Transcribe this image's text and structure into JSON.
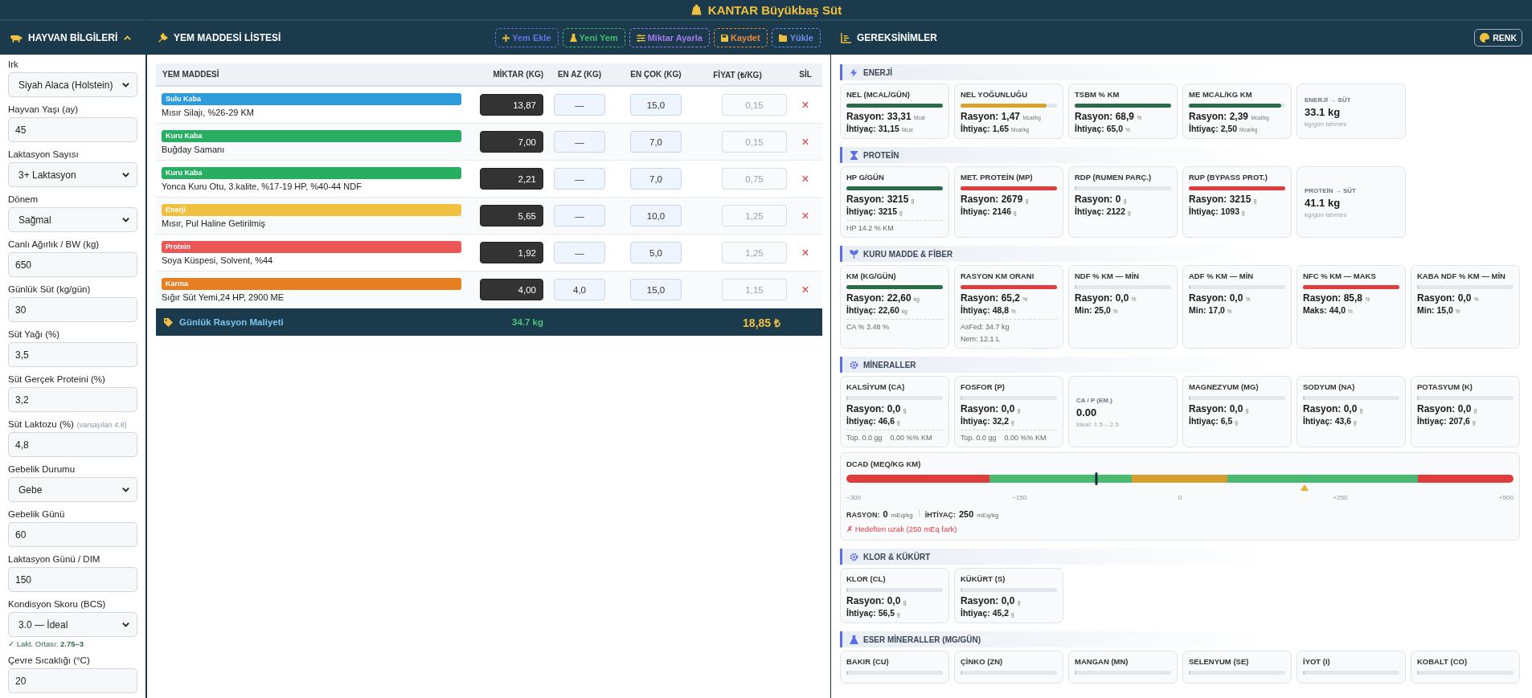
{
  "app_title": "KANTAR Büyükbaş Süt",
  "animal_panel": {
    "title": "HAYVAN BİLGİLERİ",
    "expanded": true,
    "fields": [
      {
        "label": "Irk",
        "kind": "select",
        "value": "Siyah Alaca (Holstein)"
      },
      {
        "label": "Hayvan Yaşı (ay)",
        "kind": "input",
        "value": "45"
      },
      {
        "label": "Laktasyon Sayısı",
        "kind": "select",
        "value": "3+ Laktasyon"
      },
      {
        "label": "Dönem",
        "kind": "select",
        "value": "Sağmal"
      },
      {
        "label": "Canlı Ağırlık / BW (kg)",
        "kind": "input",
        "value": "650"
      },
      {
        "label": "Günlük Süt (kg/gün)",
        "kind": "input",
        "value": "30"
      },
      {
        "label": "Süt Yağı (%)",
        "kind": "input",
        "value": "3,5"
      },
      {
        "label": "Süt Gerçek Proteini (%)",
        "kind": "input",
        "value": "3,2"
      },
      {
        "label": "Süt Laktozu (%)",
        "hint": "(varsayılan 4.8)",
        "kind": "input",
        "value": "4,8"
      },
      {
        "label": "Gebelik Durumu",
        "kind": "select",
        "value": "Gebe"
      },
      {
        "label": "Gebelik Günü",
        "kind": "input",
        "value": "60"
      },
      {
        "label": "Laktasyon Günü / DIM",
        "kind": "input",
        "value": "150"
      },
      {
        "label": "Kondisyon Skoru (BCS)",
        "kind": "select",
        "value": "3.0 — İdeal",
        "note": "✓ Lakt. Ortası: **2.75–3**"
      },
      {
        "label": "Çevre Sıcaklığı (°C)",
        "kind": "input",
        "value": "20"
      }
    ]
  },
  "feed_panel": {
    "title": "YEM MADDESİ LİSTESİ",
    "buttons": [
      {
        "label": "Yem Ekle",
        "kind": "add",
        "color": "#6373e8"
      },
      {
        "label": "Yeni Yem",
        "kind": "flask",
        "color": "#3fbf6a"
      },
      {
        "label": "Miktar Ayarla",
        "kind": "sliders",
        "color": "#a77bf0"
      },
      {
        "label": "Kaydet",
        "kind": "save",
        "color": "#f08a3c"
      },
      {
        "label": "Yükle",
        "kind": "folder",
        "color": "#6f8cf0"
      }
    ],
    "columns": [
      "YEM MADDESİ",
      "MİKTAR (KG)",
      "EN AZ (KG)",
      "EN ÇOK (KG)",
      "FİYAT (₺/KG)",
      "SİL"
    ],
    "rows": [
      {
        "category": "Sulu Kaba",
        "color": "#2e9bdb",
        "name": "Mısır Silajı, %26-29 KM",
        "amount": "13,87",
        "min": "—",
        "max": "15,0",
        "price": "0,15",
        "delete": "×"
      },
      {
        "category": "Kuru Kaba",
        "color": "#27ae60",
        "name": "Buğday Samanı",
        "amount": "7,00",
        "min": "—",
        "max": "7,0",
        "price": "0,15",
        "delete": "×"
      },
      {
        "category": "Kuru Kaba",
        "color": "#27ae60",
        "name": "Yonca Kuru Otu, 3.kalite, %17-19 HP, %40-44 NDF",
        "amount": "2,21",
        "min": "—",
        "max": "7,0",
        "price": "0,75",
        "delete": "×"
      },
      {
        "category": "Enerji",
        "color": "#f0c040",
        "name": "Mısır, Pul Haline Getirilmiş",
        "amount": "5,65",
        "min": "—",
        "max": "10,0",
        "price": "1,25",
        "delete": "×"
      },
      {
        "category": "Protein",
        "color": "#eb5757",
        "name": "Soya Küspesi, Solvent, %44",
        "amount": "1,92",
        "min": "—",
        "max": "5,0",
        "price": "1,25",
        "delete": "×"
      },
      {
        "category": "Karma",
        "color": "#e67e22",
        "name": "Sığır Süt Yemi,24 HP, 2900 ME",
        "amount": "4,00",
        "min": "4,0",
        "max": "15,0",
        "price": "1,15",
        "delete": "×"
      }
    ],
    "footer": {
      "label": "Günlük Rasyon Maliyeti",
      "total_weight": "34.7 kg",
      "total_cost": "18,85 ₺"
    }
  },
  "requirements_panel": {
    "title": "GEREKSİNİMLER",
    "color_button": "RENK",
    "sections": [
      {
        "title": "ENERJİ",
        "cards": [
          {
            "kind": "metric",
            "title": "NEL (MCAL/GÜN)",
            "level": 1,
            "color": "#2a6b48",
            "lines": [
              {
                "label": "Rasyon:",
                "value": "33,31",
                "unit": "Mcal"
              },
              {
                "label": "İhtiyaç:",
                "value": "31,15",
                "unit": "Mcal"
              }
            ]
          },
          {
            "kind": "metric",
            "title": "NEL YOĞUNLUĞU",
            "level": 0.89,
            "color": "#d9a22a",
            "lines": [
              {
                "label": "Rasyon:",
                "value": "1,47",
                "unit": "Mcal/kg"
              },
              {
                "label": "İhtiyaç:",
                "value": "1,65",
                "unit": "Mcal/kg"
              }
            ]
          },
          {
            "kind": "metric",
            "title": "TSBM % KM",
            "level": 1,
            "color": "#2a6b48",
            "lines": [
              {
                "label": "Rasyon:",
                "value": "68,9",
                "unit": "%"
              },
              {
                "label": "İhtiyaç:",
                "value": "65,0",
                "unit": "%"
              }
            ]
          },
          {
            "kind": "metric",
            "title": "ME MCAL/KG KM",
            "level": 0.96,
            "color": "#2a6b48",
            "lines": [
              {
                "label": "Rasyon:",
                "value": "2,39",
                "unit": "Mcal/kg"
              },
              {
                "label": "İhtiyaç:",
                "value": "2,50",
                "unit": "Mcal/kg"
              }
            ]
          },
          {
            "kind": "summary",
            "title": "ENERJİ → SÜT",
            "value": "33.1 kg",
            "sub": "kg/gün tahmini"
          }
        ]
      },
      {
        "title": "PROTEİN",
        "cards": [
          {
            "kind": "metric",
            "title": "HP G/GÜN",
            "level": 1,
            "color": "#2a6b48",
            "lines": [
              {
                "label": "Rasyon:",
                "value": "3215",
                "unit": "g"
              },
              {
                "label": "İhtiyaç:",
                "value": "3215",
                "unit": "g"
              }
            ],
            "notes": [
              "HP 14.2 % KM"
            ]
          },
          {
            "kind": "metric",
            "title": "MET. PROTEİN (MP)",
            "level": 1,
            "color": "#e03c3c",
            "lines": [
              {
                "label": "Rasyon:",
                "value": "2679",
                "unit": "g"
              },
              {
                "label": "İhtiyaç:",
                "value": "2146",
                "unit": "g"
              }
            ]
          },
          {
            "kind": "metric",
            "title": "RDP (RUMEN PARÇ.)",
            "level": 0,
            "lines": [
              {
                "label": "Rasyon:",
                "value": "0",
                "unit": "g"
              },
              {
                "label": "İhtiyaç:",
                "value": "2122",
                "unit": "g"
              }
            ]
          },
          {
            "kind": "metric",
            "title": "RUP (BYPASS PROT.)",
            "level": 1,
            "color": "#e03c3c",
            "lines": [
              {
                "label": "Rasyon:",
                "value": "3215",
                "unit": "g"
              },
              {
                "label": "İhtiyaç:",
                "value": "1093",
                "unit": "g"
              }
            ]
          },
          {
            "kind": "summary",
            "title": "PROTEİN → SÜT",
            "value": "41.1 kg",
            "sub": "kg/gün tahmini"
          }
        ]
      },
      {
        "title": "KURU MADDE & FİBER",
        "cards": [
          {
            "kind": "metric",
            "title": "KM (KG/GÜN)",
            "level": 1,
            "color": "#2a6b48",
            "lines": [
              {
                "label": "Rasyon:",
                "value": "22,60",
                "unit": "kg"
              },
              {
                "label": "İhtiyaç:",
                "value": "22,60",
                "unit": "kg"
              }
            ],
            "notes": [
              "CA % 3.48 %"
            ]
          },
          {
            "kind": "metric",
            "title": "RASYON KM ORANI",
            "level": 1,
            "color": "#e03c3c",
            "lines": [
              {
                "label": "Rasyon:",
                "value": "65,2",
                "unit": "%"
              },
              {
                "label": "İhtiyaç:",
                "value": "48,8",
                "unit": "%"
              }
            ],
            "notes": [
              "AsFed: 34.7 kg",
              "Nem: 12.1 L"
            ]
          },
          {
            "kind": "metric",
            "title": "NDF % KM — MİN",
            "level": 0,
            "lines": [
              {
                "label": "Rasyon:",
                "value": "0,0",
                "unit": "%"
              },
              {
                "label": "Min:",
                "value": "25,0",
                "unit": "%"
              }
            ]
          },
          {
            "kind": "metric",
            "title": "ADF % KM — MİN",
            "level": 0,
            "lines": [
              {
                "label": "Rasyon:",
                "value": "0,0",
                "unit": "%"
              },
              {
                "label": "Min:",
                "value": "17,0",
                "unit": "%"
              }
            ]
          },
          {
            "kind": "metric",
            "title": "NFC % KM — MAKS",
            "level": 1,
            "color": "#e03c3c",
            "lines": [
              {
                "label": "Rasyon:",
                "value": "85,8",
                "unit": "%"
              },
              {
                "label": "Maks:",
                "value": "44,0",
                "unit": "%"
              }
            ]
          },
          {
            "kind": "metric",
            "title": "KABA NDF % KM — MİN",
            "level": 0,
            "lines": [
              {
                "label": "Rasyon:",
                "value": "0,0",
                "unit": "%"
              },
              {
                "label": "Min:",
                "value": "15,0",
                "unit": "%"
              }
            ]
          }
        ]
      },
      {
        "title": "MİNERALLER",
        "cards": [
          {
            "kind": "metric",
            "title": "KALSİYUM (CA)",
            "level": 0,
            "lines": [
              {
                "label": "Rasyon:",
                "value": "0,0",
                "unit": "g"
              },
              {
                "label": "İhtiyaç:",
                "value": "46,6",
                "unit": "g"
              }
            ],
            "notes": [
              "Top. 0.0 gg    0.00 %% KM"
            ]
          },
          {
            "kind": "metric",
            "title": "FOSFOR (P)",
            "level": 0,
            "lines": [
              {
                "label": "Rasyon:",
                "value": "0,0",
                "unit": "g"
              },
              {
                "label": "İhtiyaç:",
                "value": "32,2",
                "unit": "g"
              }
            ],
            "notes": [
              "Top. 0.0 gg    0.00 %% KM"
            ]
          },
          {
            "kind": "summary",
            "title": "CA / P (EM.)",
            "value": "0.00",
            "sub": "İdeal: 1.5 – 2.5"
          },
          {
            "kind": "metric",
            "title": "MAGNEZYUM (MG)",
            "level": 0,
            "lines": [
              {
                "label": "Rasyon:",
                "value": "0,0",
                "unit": "g"
              },
              {
                "label": "İhtiyaç:",
                "value": "6,5",
                "unit": "g"
              }
            ]
          },
          {
            "kind": "metric",
            "title": "SODYUM (NA)",
            "level": 0,
            "lines": [
              {
                "label": "Rasyon:",
                "value": "0,0",
                "unit": "g"
              },
              {
                "label": "İhtiyaç:",
                "value": "43,6",
                "unit": "g"
              }
            ]
          },
          {
            "kind": "metric",
            "title": "POTASYUM (K)",
            "level": 0,
            "lines": [
              {
                "label": "Rasyon:",
                "value": "0,0",
                "unit": "g"
              },
              {
                "label": "İhtiyaç:",
                "value": "207,6",
                "unit": "g"
              }
            ]
          },
          {
            "kind": "dcad",
            "title": "DCAD (MEQ/KG KM)",
            "ration_marker": {
              "level": 0.375
            },
            "target_marker": {
              "level": 0.687
            },
            "ticks": [
              "−300",
              "−150",
              "0",
              "+250",
              "+500"
            ],
            "ration_label": "RASYON:",
            "ration_value": "0",
            "ration_unit": "mEq/kg",
            "need_label": "İHTİYAÇ:",
            "need_value": "250",
            "need_unit": "mEq/kg",
            "status": {
              "ok": false,
              "text": "✗ Hedeften uzak (250 mEq fark)"
            }
          }
        ]
      },
      {
        "title": "KLOR & KÜKÜRT",
        "cards": [
          {
            "kind": "metric",
            "title": "KLOR (CL)",
            "level": 0,
            "lines": [
              {
                "label": "Rasyon:",
                "value": "0,0",
                "unit": "g"
              },
              {
                "label": "İhtiyaç:",
                "value": "56,5",
                "unit": "g"
              }
            ]
          },
          {
            "kind": "metric",
            "title": "KÜKÜRT (S)",
            "level": 0,
            "lines": [
              {
                "label": "Rasyon:",
                "value": "0,0",
                "unit": "g"
              },
              {
                "label": "İhtiyaç:",
                "value": "45,2",
                "unit": "g"
              }
            ]
          }
        ]
      },
      {
        "title": "ESER MİNERALLER (MG/GÜN)",
        "cards": [
          {
            "kind": "metric",
            "title": "BAKIR (CU)",
            "level": 0
          },
          {
            "kind": "metric",
            "title": "ÇİNKO (ZN)",
            "level": 0
          },
          {
            "kind": "metric",
            "title": "MANGAN (MN)",
            "level": 0
          },
          {
            "kind": "metric",
            "title": "SELENYUM (SE)",
            "level": 0
          },
          {
            "kind": "metric",
            "title": "İYOT (I)",
            "level": 0
          },
          {
            "kind": "metric",
            "title": "KOBALT (CO)",
            "level": 0
          }
        ]
      }
    ]
  }
}
